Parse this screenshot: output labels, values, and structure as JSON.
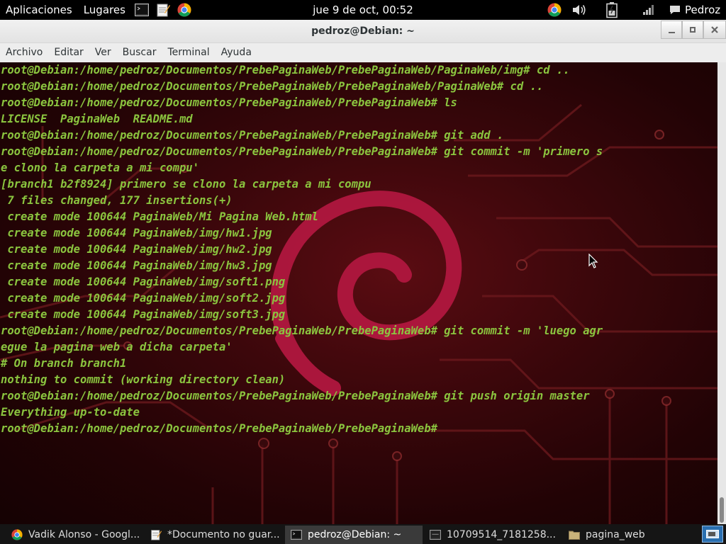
{
  "top_panel": {
    "applications": "Aplicaciones",
    "places": "Lugares",
    "clock": "jue  9 de oct, 00:52",
    "user": "Pedroz",
    "launcher_icons": [
      "terminal-launcher-icon",
      "text-editor-launcher-icon",
      "chrome-launcher-icon"
    ],
    "tray_icons": [
      "chrome-tray-icon",
      "volume-icon",
      "battery-icon",
      "signal-icon",
      "chat-icon"
    ]
  },
  "window": {
    "title": "pedroz@Debian: ~",
    "menu": [
      "Archivo",
      "Editar",
      "Ver",
      "Buscar",
      "Terminal",
      "Ayuda"
    ]
  },
  "terminal": {
    "lines": [
      "root@Debian:/home/pedroz/Documentos/PrebePaginaWeb/PrebePaginaWeb/PaginaWeb/img# cd ..",
      "root@Debian:/home/pedroz/Documentos/PrebePaginaWeb/PrebePaginaWeb/PaginaWeb# cd ..",
      "root@Debian:/home/pedroz/Documentos/PrebePaginaWeb/PrebePaginaWeb# ls",
      "LICENSE  PaginaWeb  README.md",
      "root@Debian:/home/pedroz/Documentos/PrebePaginaWeb/PrebePaginaWeb# git add .",
      "root@Debian:/home/pedroz/Documentos/PrebePaginaWeb/PrebePaginaWeb# git commit -m 'primero s",
      "e clono la carpeta a mi compu'",
      "[branch1 b2f8924] primero se clono la carpeta a mi compu",
      " 7 files changed, 177 insertions(+)",
      " create mode 100644 PaginaWeb/Mi Pagina Web.html",
      " create mode 100644 PaginaWeb/img/hw1.jpg",
      " create mode 100644 PaginaWeb/img/hw2.jpg",
      " create mode 100644 PaginaWeb/img/hw3.jpg",
      " create mode 100644 PaginaWeb/img/soft1.png",
      " create mode 100644 PaginaWeb/img/soft2.jpg",
      " create mode 100644 PaginaWeb/img/soft3.jpg",
      "root@Debian:/home/pedroz/Documentos/PrebePaginaWeb/PrebePaginaWeb# git commit -m 'luego agr",
      "egue la pagina web a dicha carpeta'",
      "# On branch branch1",
      "nothing to commit (working directory clean)",
      "root@Debian:/home/pedroz/Documentos/PrebePaginaWeb/PrebePaginaWeb# git push origin master",
      "Everything up-to-date",
      "root@Debian:/home/pedroz/Documentos/PrebePaginaWeb/PrebePaginaWeb#"
    ],
    "text_color": "#8bc53f",
    "background_color": "#3c070b",
    "swirl_color": "#c4184a"
  },
  "taskbar": {
    "tasks": [
      {
        "label": "Vadik Alonso - Googl...",
        "icon": "chrome-icon"
      },
      {
        "label": "*Documento no guar...",
        "icon": "text-editor-icon"
      },
      {
        "label": "pedroz@Debian: ~",
        "icon": "terminal-icon"
      },
      {
        "label": "10709514_7181258...",
        "icon": "image-viewer-icon"
      },
      {
        "label": "pagina_web",
        "icon": "folder-icon"
      }
    ]
  }
}
